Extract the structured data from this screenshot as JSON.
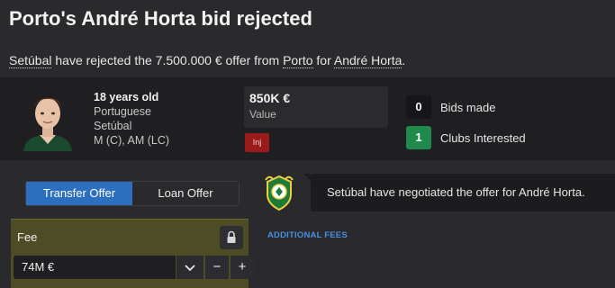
{
  "header": {
    "title": "Porto's André Horta bid rejected",
    "subtitle": {
      "club": "Setúbal",
      "text1": " have rejected the 7.500.000 € offer from ",
      "bidder": "Porto",
      "text2": " for ",
      "player": "André Horta",
      "end": "."
    }
  },
  "player": {
    "age": "18 years old",
    "nationality": "Portuguese",
    "club": "Setúbal",
    "position": "M (C), AM (LC)",
    "value_amount": "850K €",
    "value_label": "Value",
    "injury_badge": "Inj"
  },
  "stats": {
    "bids_made_count": "0",
    "bids_made_label": "Bids made",
    "clubs_interested_count": "1",
    "clubs_interested_label": "Clubs Interested"
  },
  "offer_tabs": {
    "transfer": "Transfer Offer",
    "loan": "Loan Offer"
  },
  "message": "Setúbal have negotiated the offer for André Horta.",
  "fee": {
    "label": "Fee",
    "value": "74M €",
    "dropdown_glyph": "⌄",
    "minus_glyph": "−",
    "plus_glyph": "+"
  },
  "additional_fees_label": "ADDITIONAL FEES",
  "colors": {
    "accent_blue": "#2d6fbf",
    "clubs_green": "#1f8a4c",
    "injury_red": "#9b1b1b",
    "fee_panel": "#4e4c24"
  }
}
